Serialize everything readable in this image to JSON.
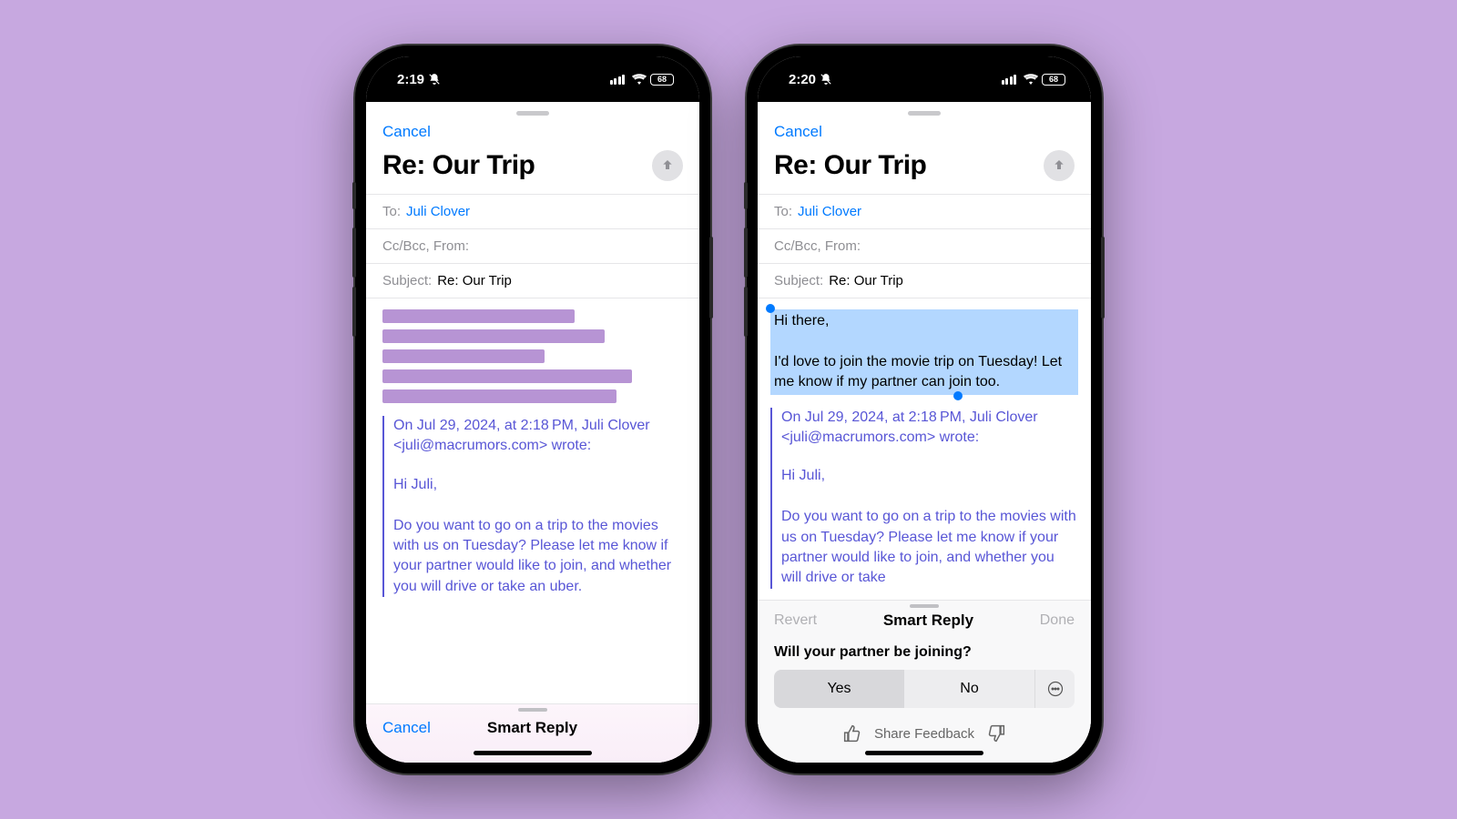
{
  "leftPhone": {
    "status": {
      "time": "2:19",
      "battery": "68"
    },
    "cancel": "Cancel",
    "title": "Re: Our Trip",
    "to_label": "To:",
    "to_value": "Juli Clover",
    "cc_label": "Cc/Bcc, From:",
    "subject_label": "Subject:",
    "subject_value": "Re: Our Trip",
    "quote_header": "On Jul 29, 2024, at 2:18 PM, Juli Clover <juli@macrumors.com> wrote:",
    "quote_greeting": "Hi Juli,",
    "quote_body": "Do you want to go on a trip to the movies with us on Tuesday? Please let me know if your partner would like to join, and whether you will drive or take an uber.",
    "bottom": {
      "cancel": "Cancel",
      "title": "Smart Reply"
    }
  },
  "rightPhone": {
    "status": {
      "time": "2:20",
      "battery": "68"
    },
    "cancel": "Cancel",
    "title": "Re: Our Trip",
    "to_label": "To:",
    "to_value": "Juli Clover",
    "cc_label": "Cc/Bcc, From:",
    "subject_label": "Subject:",
    "subject_value": "Re: Our Trip",
    "reply_greeting": "Hi there,",
    "reply_body": "I'd love to join the movie trip on Tuesday! Let me know if my partner can join too.",
    "quote_header": "On Jul 29, 2024, at 2:18 PM, Juli Clover <juli@macrumors.com> wrote:",
    "quote_greeting": "Hi Juli,",
    "quote_body": "Do you want to go on a trip to the movies with us on Tuesday? Please let me know if your partner would like to join, and whether you will drive or take",
    "panel": {
      "revert": "Revert",
      "title": "Smart Reply",
      "done": "Done",
      "question": "Will your partner be joining?",
      "yes": "Yes",
      "no": "No",
      "feedback": "Share Feedback"
    }
  }
}
